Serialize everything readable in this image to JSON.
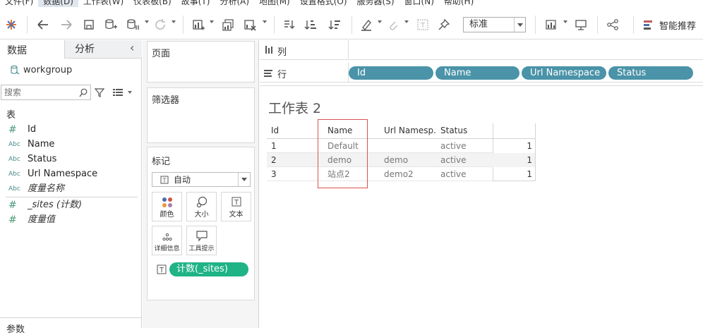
{
  "menubar": {
    "items": [
      "文件(F)",
      "数据(D)",
      "工作表(W)",
      "仪表板(B)",
      "故事(T)",
      "分析(A)",
      "地图(M)",
      "设置格式(O)",
      "服务器(S)",
      "窗口(N)",
      "帮助(H)"
    ],
    "selected_index": 1
  },
  "toolbar": {
    "format_select": "标准",
    "show_me_label": "智能推荐"
  },
  "left_panel": {
    "tab_data": "数据",
    "tab_analysis": "分析",
    "collapse_glyph": "‹",
    "datasource": "workgroup",
    "search_placeholder": "搜索",
    "tables_header": "表",
    "fields": [
      {
        "type": "#",
        "name": "Id",
        "italic": false
      },
      {
        "type": "Abc",
        "name": "Name",
        "italic": false
      },
      {
        "type": "Abc",
        "name": "Status",
        "italic": false
      },
      {
        "type": "Abc",
        "name": "Url Namespace",
        "italic": false
      },
      {
        "type": "Abc",
        "name": "度量名称",
        "italic": true
      }
    ],
    "measures": [
      {
        "type": "#",
        "name": "_sites (计数)",
        "italic": true
      },
      {
        "type": "#",
        "name": "度量值",
        "italic": true
      }
    ],
    "params_header": "参数"
  },
  "cards": {
    "pages_title": "页面",
    "filters_title": "筛选器",
    "marks_title": "标记",
    "mark_type": "自动",
    "buttons": {
      "color": "颜色",
      "size": "大小",
      "text": "文本",
      "detail": "详细信息",
      "tooltip": "工具提示"
    },
    "text_pill": "计数(_sites)"
  },
  "shelves": {
    "columns_label": "列",
    "rows_label": "行",
    "row_pills": [
      "Id",
      "Name",
      "Url Namespace",
      "Status"
    ]
  },
  "sheet": {
    "title": "工作表 2",
    "headers": [
      "Id",
      "Name",
      "Url Namesp..",
      "Status"
    ],
    "rows": [
      {
        "id": "1",
        "name": "Default",
        "url": "",
        "status": "active",
        "count": "1"
      },
      {
        "id": "2",
        "name": "demo",
        "url": "demo",
        "status": "active",
        "count": "1"
      },
      {
        "id": "3",
        "name": "站点2",
        "url": "demo2",
        "status": "active",
        "count": "1"
      }
    ],
    "highlight_color": "#d9534f"
  }
}
